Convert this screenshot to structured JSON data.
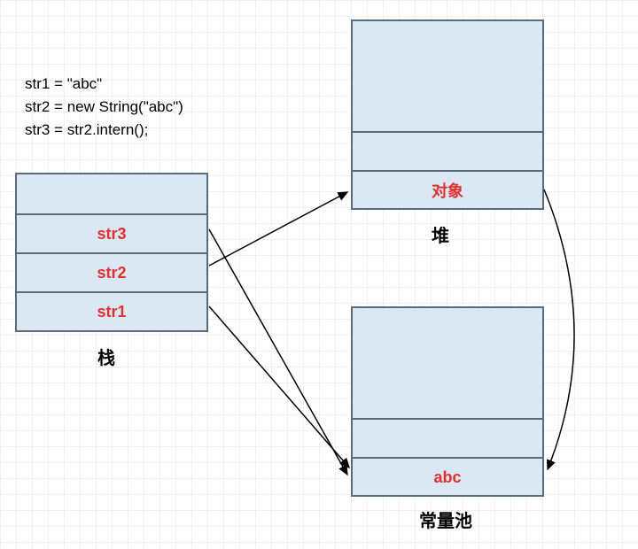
{
  "code": {
    "line1": "str1 = \"abc\"",
    "line2": "str2 = new String(\"abc\")",
    "line3": "str3 = str2.intern();"
  },
  "stack": {
    "label": "栈",
    "rows": {
      "r0": "",
      "r1": "str3",
      "r2": "str2",
      "r3": "str1"
    }
  },
  "heap": {
    "label": "堆",
    "rows": {
      "r0": "",
      "r1": "",
      "r2": "对象"
    }
  },
  "pool": {
    "label": "常量池",
    "rows": {
      "r0": "",
      "r1": "",
      "r2": "abc"
    }
  }
}
